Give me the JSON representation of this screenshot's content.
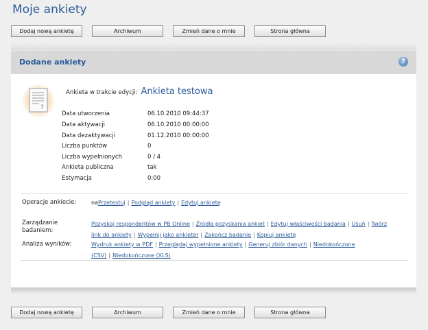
{
  "page": {
    "title": "Moje ankiety"
  },
  "toolbar": {
    "add_label": "Dodaj nową ankietę",
    "archive_label": "Archiwum",
    "change_data_label": "Zmień dane o mnie",
    "home_label": "Strona główna"
  },
  "panel": {
    "title": "Dodane ankiety",
    "help_icon": "help-icon",
    "help_glyph": "?"
  },
  "survey": {
    "icon": "document-icon",
    "label": "Ankieta w trakcie edycji:",
    "name": "Ankieta testowa",
    "details": [
      {
        "label": "Data utworzenia",
        "value": "06.10.2010 09:44:37"
      },
      {
        "label": "Data aktywacji",
        "value": "06.10.2010 00:00:00"
      },
      {
        "label": "Data dezaktywacji",
        "value": "01.12.2010 00:00:00"
      },
      {
        "label": "Liczba punktów",
        "value": "0"
      },
      {
        "label": "Liczba wypełnionych",
        "value": "0 / 4"
      },
      {
        "label": "Ankieta publiczna",
        "value": "tak"
      },
      {
        "label": "Estymacja",
        "value": "0:00"
      }
    ]
  },
  "operations": {
    "label": "Operacje ankiecie:",
    "prefix": "na",
    "links": [
      "Przetestuj",
      "Podgląd ankiety",
      "Edytuj ankietę"
    ]
  },
  "management": {
    "label": "Zarządzanie badaniem:",
    "links": [
      "Pozyskaj respondentów w PB Online",
      "Źródła pozyskania ankiet",
      "Edytuj właściwości badania",
      "Usuń",
      "Twórz link do ankiety",
      "Wypełnij jako ankieter",
      "Zakończ badanie",
      "Kopiuj ankietę"
    ]
  },
  "analysis": {
    "label": "Analiza wyników:",
    "links": [
      "Wydruk ankiety w PDF",
      "Przeglądaj wypełnione ankiety",
      "Generuj zbiór danych",
      "Niedokończone (CSV)",
      "Niedokończone (XLS)"
    ]
  }
}
